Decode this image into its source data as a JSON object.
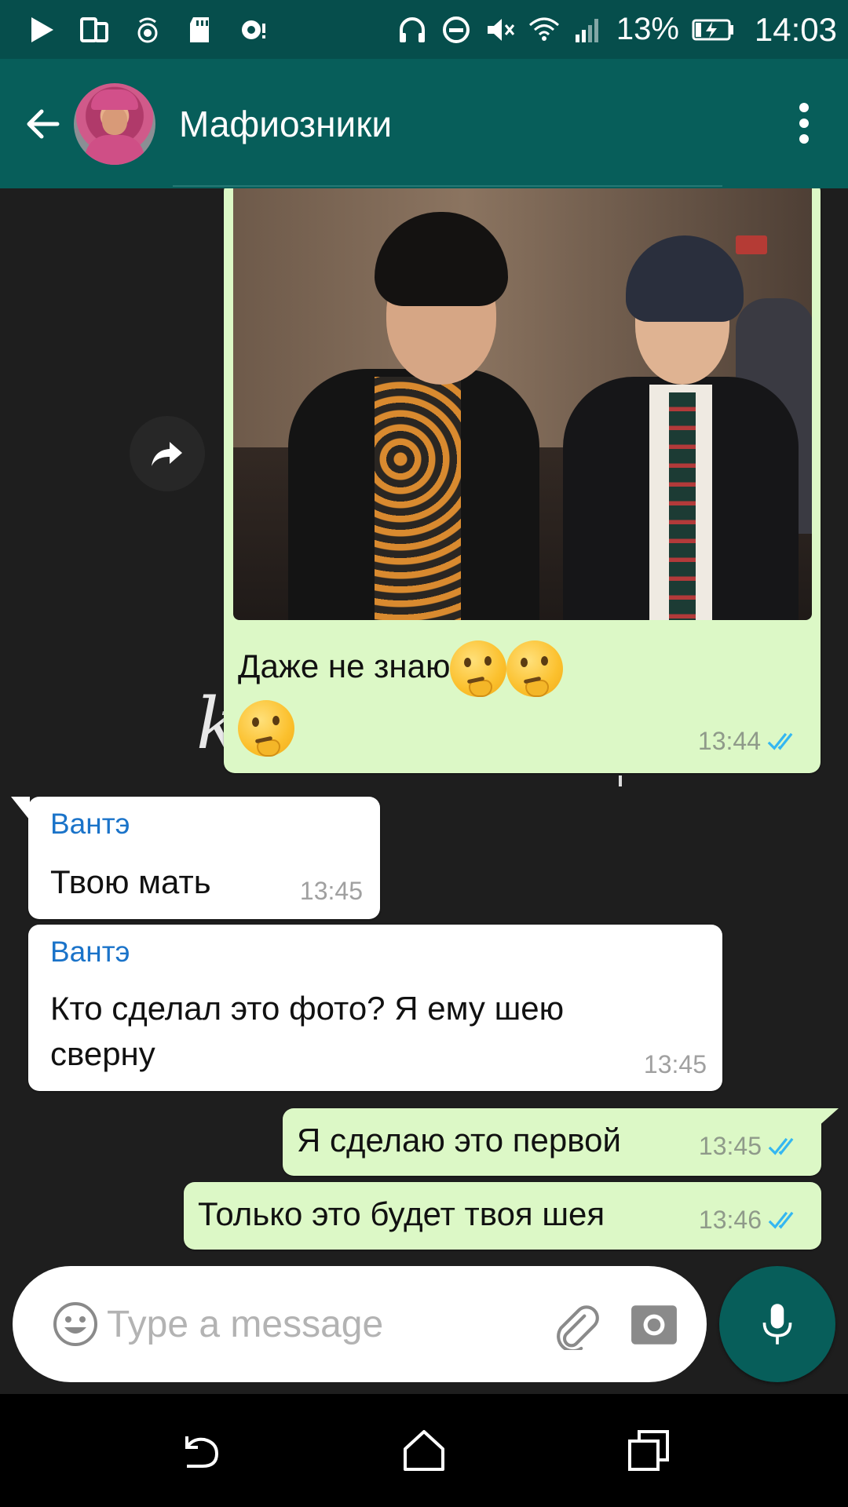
{
  "status_bar": {
    "battery": "13%",
    "time": "14:03",
    "icons": [
      "play-icon",
      "screen-mirror-icon",
      "hotspot-icon",
      "sd-card-icon",
      "cloud-sync-icon",
      "headphones-icon",
      "do-not-disturb-icon",
      "mute-icon",
      "wifi-icon",
      "signal-icon",
      "battery-charging-icon"
    ]
  },
  "header": {
    "title": "Мафиозники",
    "back_icon": "arrow-left-icon",
    "menu_icon": "more-vertical-icon"
  },
  "messages": [
    {
      "type": "image",
      "direction": "out",
      "caption": "Даже не знаю",
      "emoji": "thinking-face",
      "time": "13:44",
      "status": "read"
    },
    {
      "type": "text",
      "direction": "in",
      "sender": "Вантэ",
      "text": "Твою мать",
      "time": "13:45"
    },
    {
      "type": "text",
      "direction": "in",
      "sender": "Вантэ",
      "text_line1": "Кто сделал это фото? Я ему шею",
      "text_line2": "сверну",
      "time": "13:45"
    },
    {
      "type": "text",
      "direction": "out",
      "text": "Я сделаю это первой",
      "time": "13:45",
      "status": "read"
    },
    {
      "type": "text",
      "direction": "out",
      "text": "Только это будет твоя шея",
      "time": "13:46",
      "status": "read"
    }
  ],
  "input": {
    "placeholder": "Type a message"
  },
  "colors": {
    "header": "#075e5a",
    "status_bar": "#064e4c",
    "outgoing_bubble": "#dcf8c6",
    "incoming_bubble": "#ffffff",
    "sender_name": "#1a73c9",
    "read_ticks": "#34b7f1"
  }
}
